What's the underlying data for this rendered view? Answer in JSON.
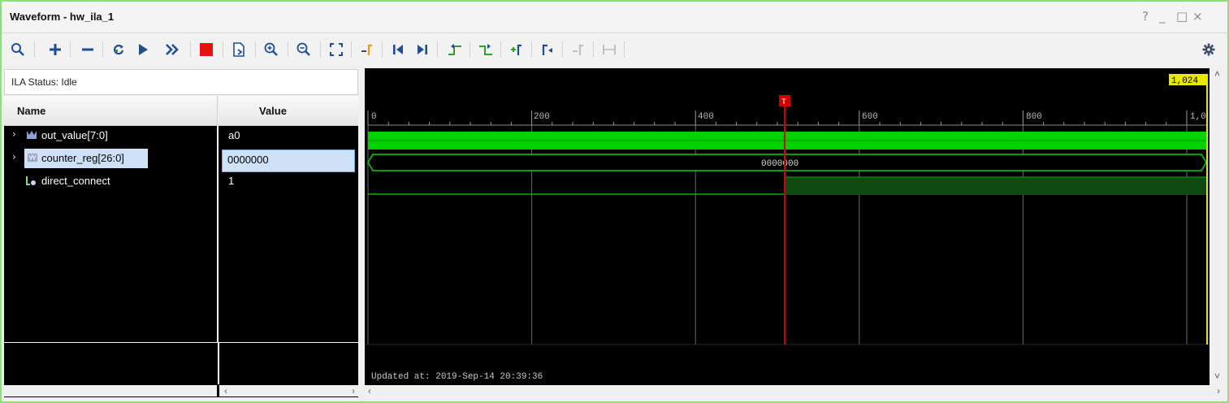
{
  "window": {
    "title": "Waveform - hw_ila_1",
    "controls": {
      "help": "?",
      "minimize": "_",
      "maximize": "□",
      "close": "×"
    }
  },
  "toolbar": {
    "buttons": [
      {
        "name": "search-button",
        "icon": "magnifier",
        "glyph": "⚲"
      },
      {
        "name": "add-button",
        "icon": "plus",
        "glyph": "+"
      },
      {
        "name": "remove-button",
        "icon": "minus",
        "glyph": "−"
      },
      {
        "name": "run-trigger-immediate-button",
        "icon": "refresh-arrow",
        "glyph": "↻"
      },
      {
        "name": "run-trigger-button",
        "icon": "play",
        "glyph": "▶"
      },
      {
        "name": "run-immediate-button",
        "icon": "double-chevron",
        "glyph": "»"
      },
      {
        "name": "stop-button",
        "icon": "stop-square",
        "glyph": ""
      },
      {
        "name": "export-button",
        "icon": "document-export",
        "glyph": "⎘"
      },
      {
        "name": "zoom-in-button",
        "icon": "zoom-in",
        "glyph": "⊕"
      },
      {
        "name": "zoom-out-button",
        "icon": "zoom-out",
        "glyph": "⊖"
      },
      {
        "name": "zoom-fit-button",
        "icon": "zoom-fit",
        "glyph": "⛶"
      },
      {
        "name": "go-to-cursor-button",
        "icon": "go-to-cursor",
        "glyph": "⇥"
      },
      {
        "name": "go-to-time-zero-button",
        "icon": "skip-start",
        "glyph": "⏮"
      },
      {
        "name": "go-to-last-time-button",
        "icon": "skip-end",
        "glyph": "⏭"
      },
      {
        "name": "previous-transition-button",
        "icon": "prev-transition",
        "glyph": "⇤"
      },
      {
        "name": "next-transition-button",
        "icon": "next-transition",
        "glyph": "⇥"
      },
      {
        "name": "add-marker-button",
        "icon": "add-marker",
        "glyph": "+"
      },
      {
        "name": "previous-marker-button",
        "icon": "prev-marker",
        "glyph": "⇤"
      },
      {
        "name": "next-marker-button",
        "icon": "next-marker",
        "glyph": "⇥"
      },
      {
        "name": "swap-cursors-button",
        "icon": "swap-cursors",
        "glyph": "⟷"
      }
    ],
    "settings_icon": "gear"
  },
  "status": {
    "text": "ILA Status: Idle"
  },
  "columns": {
    "name": "Name",
    "value": "Value"
  },
  "signals": [
    {
      "name": "out_value[7:0]",
      "value": "a0",
      "icon": "bus",
      "expandable": true,
      "selected": false
    },
    {
      "name": "counter_reg[26:0]",
      "value": "0000000",
      "icon": "register-bus",
      "expandable": true,
      "selected": true
    },
    {
      "name": "direct_connect",
      "value": "1",
      "icon": "logic-bit",
      "expandable": false,
      "selected": false
    }
  ],
  "waveform": {
    "ruler_labels": [
      "0",
      "200",
      "400",
      "600",
      "800",
      "1,0"
    ],
    "end_marker_label": "1,024",
    "trigger_marker_label": "T",
    "bus_label": "0000000",
    "updated_text": "Updated at: 2019-Sep-14 20:39:36",
    "colors": {
      "background": "#000000",
      "waveform": "#00d200",
      "trigger": "#cc0000",
      "cursor_end": "#e8e800",
      "gridline": "#6a6a6a"
    }
  }
}
